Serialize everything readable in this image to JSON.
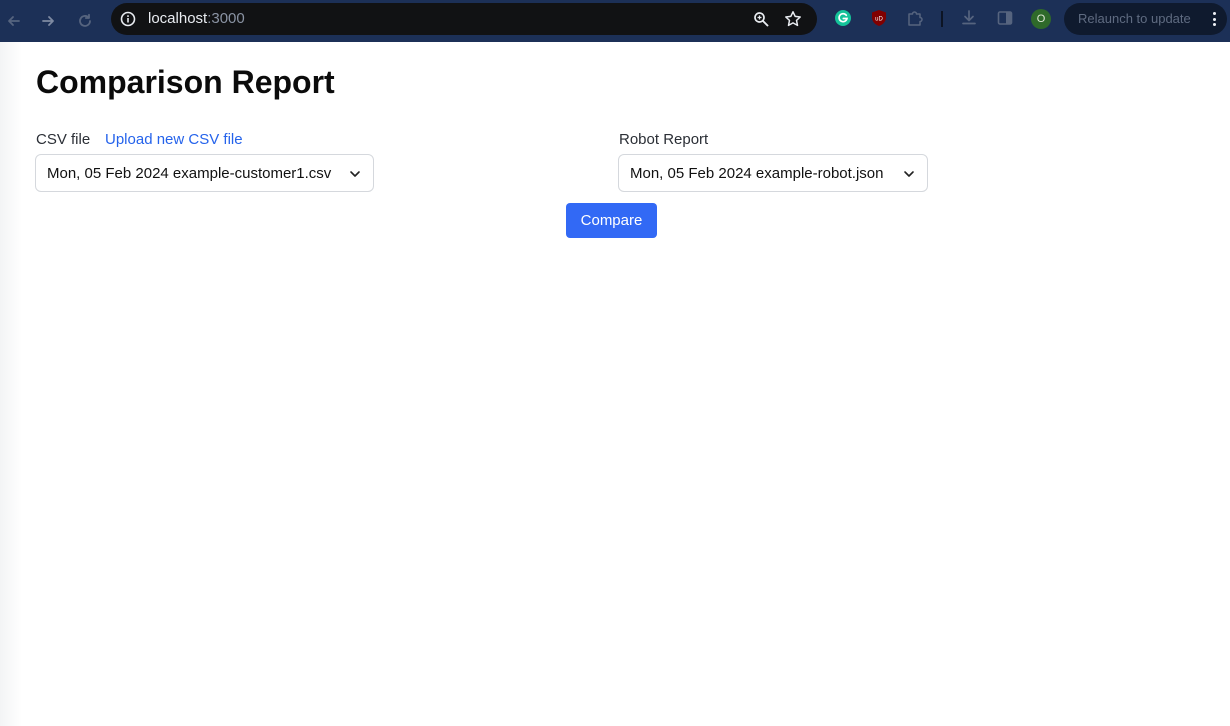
{
  "browser": {
    "url_host": "localhost",
    "url_port": ":3000",
    "relaunch_label": "Relaunch to update",
    "profile_initial": "O",
    "extension_badge": "uD"
  },
  "page": {
    "title": "Comparison Report",
    "csv": {
      "label": "CSV file",
      "upload_link": "Upload new CSV file",
      "selected": "Mon, 05 Feb 2024 example-customer1.csv"
    },
    "robot": {
      "label": "Robot Report",
      "selected": "Mon, 05 Feb 2024 example-robot.json"
    },
    "compare_label": "Compare"
  },
  "colors": {
    "toolbar": "#1c3057",
    "link": "#2563eb",
    "button": "#3269f5"
  }
}
